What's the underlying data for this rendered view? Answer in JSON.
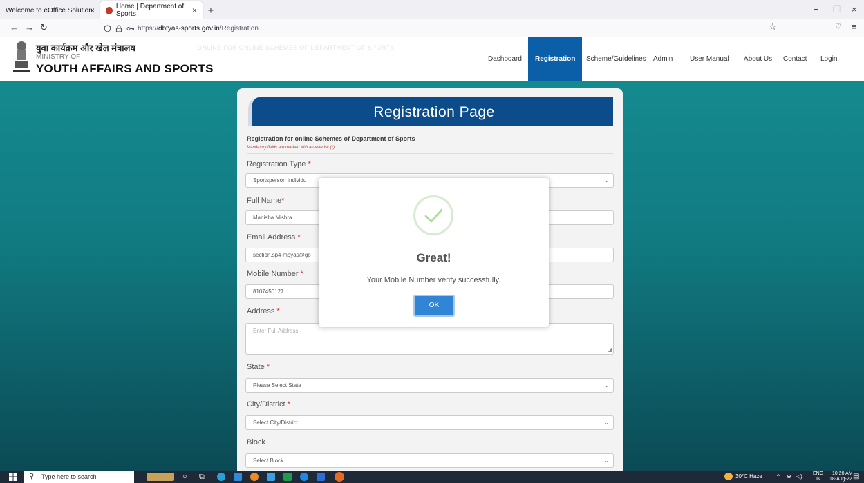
{
  "browser": {
    "tabs": [
      {
        "title": "Welcome to eOffice Solution",
        "active": false
      },
      {
        "title": "Home | Department of Sports",
        "active": true
      }
    ],
    "url_prefix": "https://",
    "url_host": "dbtyas-sports.gov.in",
    "url_path": "/Registration"
  },
  "header": {
    "hindi_title": "युवा कार्यक्रम और खेल मंत्रालय",
    "ministry_of": "MINISTRY OF",
    "ministry_name": "YOUTH AFFAIRS AND SPORTS",
    "marquee": "ONLINE FOR ONLINE SCHEMES OF DEPARTMENT OF SPORTS",
    "nav": [
      {
        "label": "Dashboard",
        "active": false
      },
      {
        "label": "Registration",
        "active": true
      },
      {
        "label": "Scheme/Guidelines",
        "active": false
      },
      {
        "label": "Admin",
        "active": false
      },
      {
        "label": "User Manual",
        "active": false
      },
      {
        "label": "About Us",
        "active": false
      },
      {
        "label": "Contact",
        "active": false
      },
      {
        "label": "Login",
        "active": false
      }
    ]
  },
  "form": {
    "title": "Registration Page",
    "subtitle": "Registration for online Schemes of Department of Sports",
    "mandatory_note": "Mandatory fields are marked with an asterisk (*)",
    "fields": {
      "registration_type": {
        "label": "Registration Type",
        "value": "Sportsperson Individu"
      },
      "full_name": {
        "label": "Full Name",
        "value": "Manisha Mishra"
      },
      "email": {
        "label": "Email Address",
        "value": "section.sp4-moyas@go"
      },
      "mobile": {
        "label": "Mobile Number",
        "value": "8107450127"
      },
      "address": {
        "label": "Address",
        "placeholder": "Enter Full Address"
      },
      "state": {
        "label": "State",
        "value": "Please Select State"
      },
      "city": {
        "label": "City/District",
        "value": "Select City/District"
      },
      "block": {
        "label": "Block",
        "value": "Select Block"
      }
    },
    "required_mark": "*"
  },
  "modal": {
    "title": "Great!",
    "message": "Your Mobile Number verify successfully.",
    "ok_label": "OK"
  },
  "taskbar": {
    "search_placeholder": "Type here to search",
    "weather": "30°C Haze",
    "lang": "ENG",
    "region": "IN",
    "time": "10:20 AM",
    "date": "18-Aug-22"
  },
  "colors": {
    "accent_blue": "#0b5fa8",
    "banner_blue": "#0c4c8a",
    "teal_bg": "#148a8f",
    "ok_button": "#3085d6",
    "success_green": "#a5dc86",
    "required_red": "#d9302c"
  }
}
